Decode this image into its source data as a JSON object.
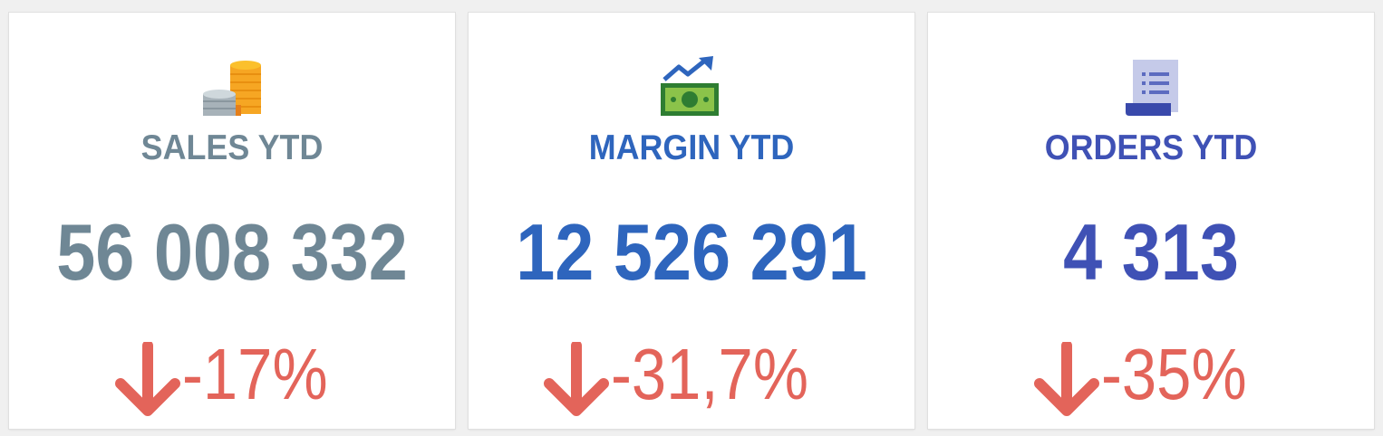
{
  "cards": [
    {
      "title": "SALES YTD",
      "value": "56 008 332",
      "change": "-17%",
      "icon": "coins-icon",
      "color": "#6f8795"
    },
    {
      "title": "MARGIN YTD",
      "value": "12 526 291",
      "change": "-31,7%",
      "icon": "money-growth-icon",
      "color": "#2e65bd"
    },
    {
      "title": "ORDERS YTD",
      "value": "4 313",
      "change": "-35%",
      "icon": "receipt-icon",
      "color": "#3f51b5"
    }
  ],
  "change_color": "#e3645a",
  "change_direction": "down"
}
